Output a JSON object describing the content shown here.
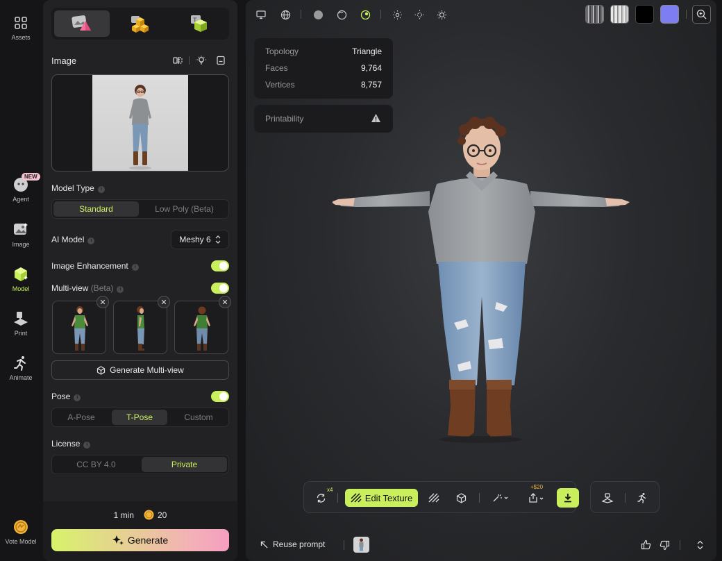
{
  "nav": {
    "items": [
      {
        "label": "Assets",
        "icon": "grid-icon"
      },
      {
        "label": "Agent",
        "icon": "agent-icon",
        "badge": "NEW"
      },
      {
        "label": "Image",
        "icon": "image-icon"
      },
      {
        "label": "Model",
        "icon": "cube-icon",
        "active": true
      },
      {
        "label": "Print",
        "icon": "printer-icon"
      },
      {
        "label": "Animate",
        "icon": "running-icon"
      },
      {
        "label": "Vote Model",
        "icon": "vote-icon"
      }
    ]
  },
  "panel": {
    "image_title": "Image",
    "model_type": {
      "label": "Model Type",
      "options": [
        "Standard",
        "Low Poly (Beta)"
      ],
      "selected": "Standard"
    },
    "ai_model": {
      "label": "AI Model",
      "value": "Meshy 6"
    },
    "image_enhancement": {
      "label": "Image Enhancement",
      "enabled": true
    },
    "multiview": {
      "label": "Multi-view",
      "suffix": "(Beta)",
      "enabled": true,
      "generate_label": "Generate Multi-view"
    },
    "pose": {
      "label": "Pose",
      "enabled": true,
      "options": [
        "A-Pose",
        "T-Pose",
        "Custom"
      ],
      "selected": "T-Pose"
    },
    "license": {
      "label": "License",
      "options": [
        "CC BY 4.0",
        "Private"
      ],
      "selected": "Private"
    },
    "footer": {
      "time": "1 min",
      "credits": "20",
      "generate_label": "Generate"
    }
  },
  "viewport": {
    "stats": {
      "topology_label": "Topology",
      "topology_value": "Triangle",
      "faces_label": "Faces",
      "faces_value": "9,764",
      "vertices_label": "Vertices",
      "vertices_value": "8,757"
    },
    "printability_label": "Printability",
    "toolbar": {
      "remesh_badge": "x4",
      "edit_texture_label": "Edit Texture",
      "export_badge": "+$20"
    },
    "reuse_prompt_label": "Reuse prompt"
  },
  "colors": {
    "accent": "#c9f05c",
    "panel": "#222224",
    "background": "#151517"
  }
}
